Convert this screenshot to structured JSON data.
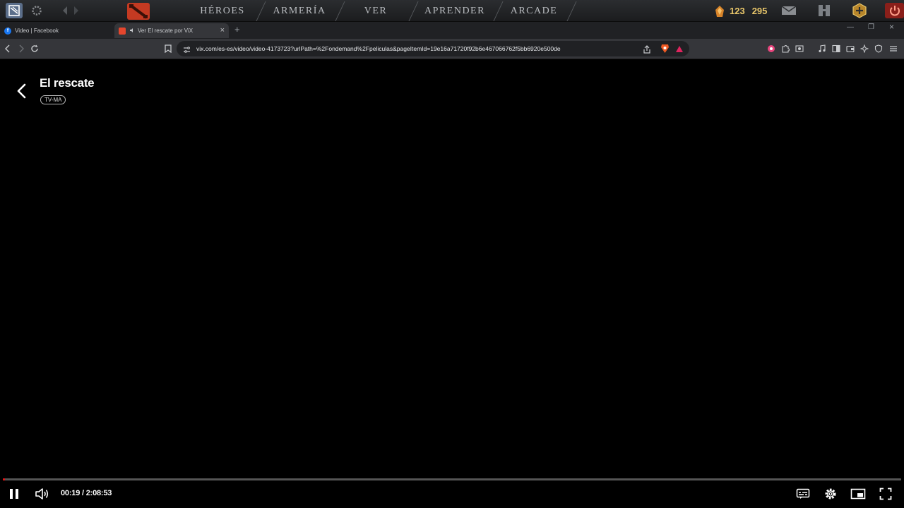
{
  "game_bar": {
    "nav_tabs": [
      "HÉROES",
      "ARMERÍA",
      "VER",
      "APRENDER",
      "ARCADE"
    ],
    "currency_1": "123",
    "currency_2": "295"
  },
  "browser": {
    "tabs": [
      {
        "label": "Video | Facebook",
        "active": false
      },
      {
        "label": "Ver El rescate por ViX",
        "active": true
      }
    ],
    "url": "vix.com/es-es/video/video-4173723?urlPath=%2Fondemand%2Fpeliculas&pageItemId=19e16a71720f92b6e467066762f5bb6920e500de"
  },
  "video": {
    "title": "El rescate",
    "rating": "TV-MA",
    "current_time": "00:19",
    "duration": "2:08:53",
    "time_display": "00:19 / 2:08:53",
    "progress_fraction": 0.0025
  },
  "colors": {
    "progress_played": "#ee1111",
    "accent_facebook": "#1877f2",
    "vix_brand": "#e5462d"
  }
}
